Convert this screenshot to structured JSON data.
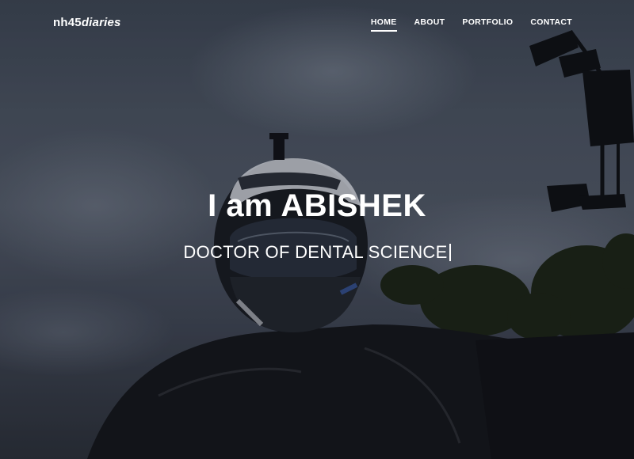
{
  "brand": {
    "logo_bold": "nh45",
    "logo_italic": "diaries"
  },
  "nav": {
    "items": [
      {
        "label": "HOME",
        "active": true
      },
      {
        "label": "ABOUT",
        "active": false
      },
      {
        "label": "PORTFOLIO",
        "active": false
      },
      {
        "label": "CONTACT",
        "active": false
      }
    ]
  },
  "hero": {
    "headline": "I am ABISHEK",
    "subline": "DOCTOR OF DENTAL SCIENCE",
    "background_image": "rider-with-helmet-photo"
  },
  "colors": {
    "text": "#ffffff",
    "sky": "#4a5361"
  }
}
